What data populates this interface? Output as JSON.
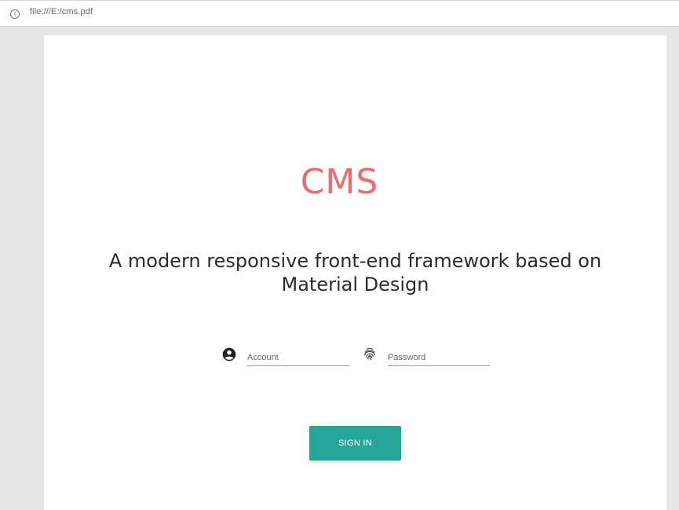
{
  "browser": {
    "url": "file:///E:/cms.pdf",
    "info_icon": "i"
  },
  "page": {
    "logo": "CMS",
    "tagline": "A modern responsive front-end framework based on Material Design"
  },
  "login": {
    "account": {
      "icon": "account-circle-icon",
      "placeholder": "Account",
      "value": ""
    },
    "password": {
      "icon": "fingerprint-icon",
      "placeholder": "Password",
      "value": ""
    },
    "signin_label": "SIGN IN"
  },
  "colors": {
    "logo": "#ef6a6a",
    "button": "#26a69a"
  }
}
